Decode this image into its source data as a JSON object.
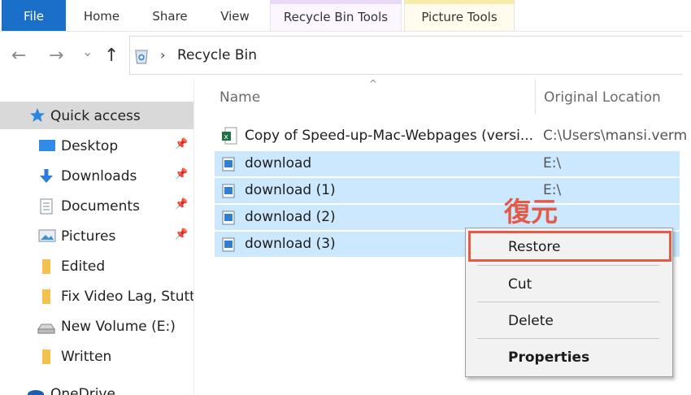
{
  "ribbon": {
    "file": "File",
    "home": "Home",
    "share": "Share",
    "view": "View",
    "recycle_bin_tools": "Recycle Bin Tools",
    "picture_tools": "Picture Tools"
  },
  "address": {
    "back": "←",
    "forward": "→",
    "history": "⌄",
    "up": "↑",
    "separator": "›",
    "location": "Recycle Bin"
  },
  "nav": {
    "pin_glyph": "📌",
    "items": [
      {
        "label": "Quick access"
      },
      {
        "label": "Desktop"
      },
      {
        "label": "Downloads"
      },
      {
        "label": "Documents"
      },
      {
        "label": "Pictures"
      },
      {
        "label": "Edited"
      },
      {
        "label": "Fix Video Lag, Stutte"
      },
      {
        "label": "New Volume (E:)"
      },
      {
        "label": "Written"
      },
      {
        "label": "OneDrive"
      }
    ]
  },
  "columns": {
    "name": "Name",
    "sort_indicator": "^",
    "original_location": "Original Location"
  },
  "files": [
    {
      "name": "Copy of Speed-up-Mac-Webpages (versi...",
      "location": "C:\\Users\\mansi.verm"
    },
    {
      "name": "download",
      "location": "E:\\"
    },
    {
      "name": "download (1)",
      "location": "E:\\"
    },
    {
      "name": "download (2)",
      "location": ""
    },
    {
      "name": "download (3)",
      "location": ""
    }
  ],
  "context_menu": {
    "restore": "Restore",
    "cut": "Cut",
    "delete": "Delete",
    "properties": "Properties"
  },
  "annotation": {
    "callout": "復元",
    "color": "#e35a47"
  },
  "colors": {
    "file_tab": "#1a6fc9",
    "selection": "#cce8ff",
    "nav_selected": "#d9d9d9"
  }
}
